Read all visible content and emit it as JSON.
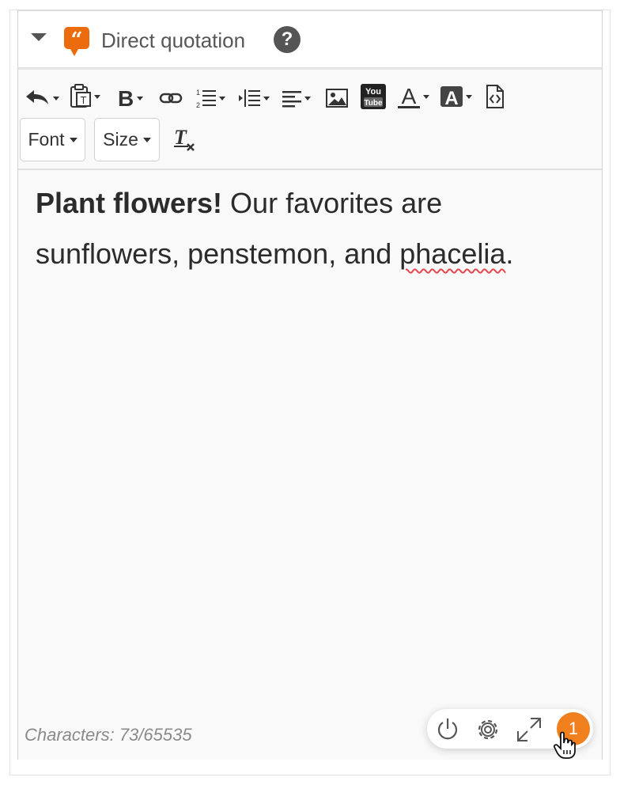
{
  "section": {
    "title": "Direct quotation",
    "help_symbol": "?",
    "quote_icon": "quote-icon",
    "colors": {
      "quote_icon": "#ec6b0c",
      "badge": "#f07f1e"
    }
  },
  "toolbar": {
    "font_label": "Font",
    "size_label": "Size",
    "youtube_top": "You",
    "youtube_bottom": "Tube",
    "text_color_glyph": "A",
    "bg_color_glyph": "A"
  },
  "content": {
    "bold": "Plant flowers!",
    "text_a": "  Our favorites are sunflowers, penstemon, and ",
    "misspelled": "phacelia",
    "text_b": "."
  },
  "footer": {
    "characters": "Characters: 73/65535",
    "badge_count": "1"
  }
}
